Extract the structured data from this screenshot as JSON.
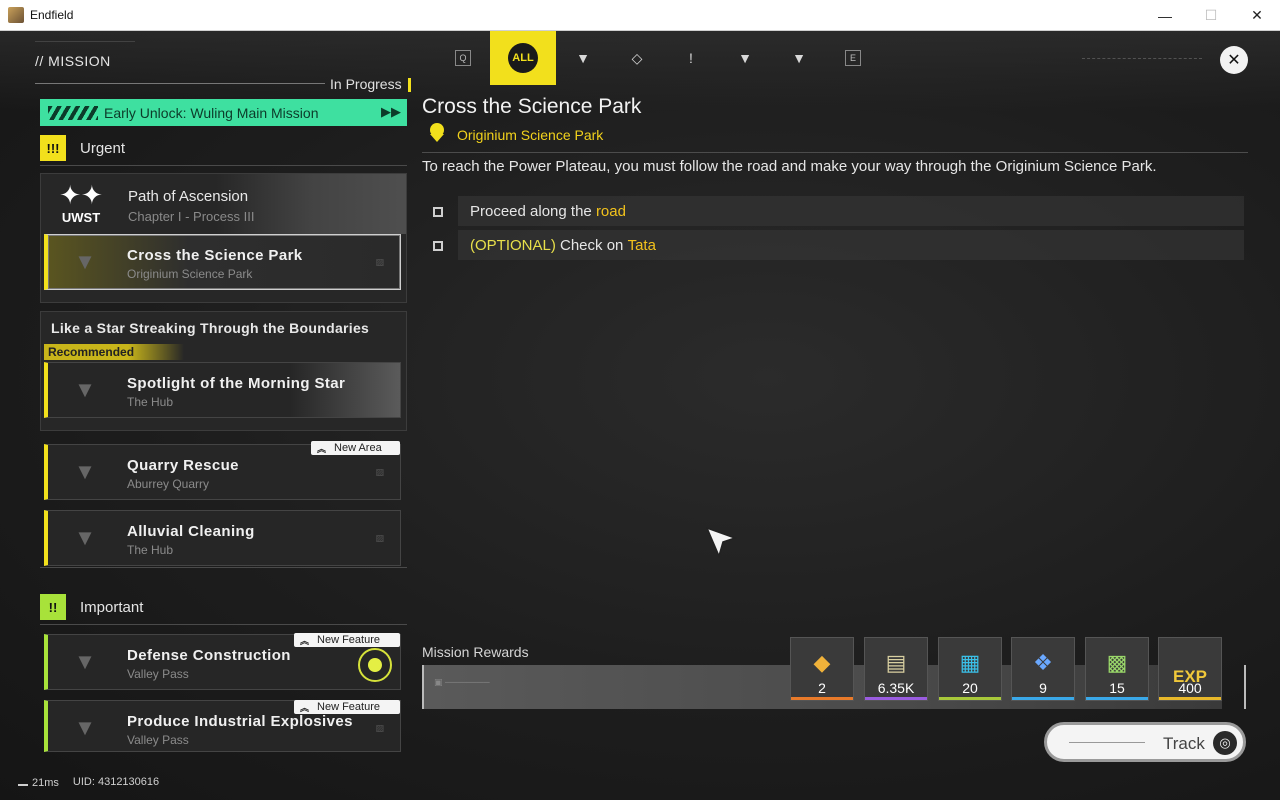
{
  "window": {
    "title": "Endfield",
    "minimize": "—",
    "maximize": "☐",
    "close": "✕"
  },
  "header": {
    "section_title": "// MISSION"
  },
  "tabs": [
    {
      "label": "Q"
    },
    {
      "label": "ALL"
    },
    {
      "label": "▼"
    },
    {
      "label": "◇"
    },
    {
      "label": "!"
    },
    {
      "label": "▼"
    },
    {
      "label": "▼"
    },
    {
      "label": "E"
    }
  ],
  "list": {
    "in_progress_label": "In Progress",
    "early_unlock": "Early Unlock: Wuling Main Mission",
    "urgent": {
      "badge": "!!!",
      "label": "Urgent"
    },
    "important": {
      "badge": "!!",
      "label": "Important"
    },
    "group1": {
      "logo_text": "UWST",
      "title": "Path of Ascension",
      "subtitle": "Chapter I - Process III"
    },
    "group2": {
      "title": "Like a Star Streaking Through the Boundaries",
      "recommended": "Recommended"
    },
    "missions": [
      {
        "title": "Cross the Science Park",
        "location": "Originium Science Park"
      },
      {
        "title": "Spotlight of the Morning Star",
        "location": "The Hub"
      },
      {
        "title": "Quarry Rescue",
        "location": "Aburrey Quarry",
        "badge": "New Area"
      },
      {
        "title": "Alluvial Cleaning",
        "location": "The Hub"
      },
      {
        "title": "Defense Construction",
        "location": "Valley Pass",
        "badge": "New Feature"
      },
      {
        "title": "Produce Industrial Explosives",
        "location": "Valley Pass",
        "badge": "New Feature"
      }
    ]
  },
  "detail": {
    "title": "Cross the Science Park",
    "location": "Originium Science Park",
    "description": "To reach the Power Plateau, you must follow the road and make your way through the Originium Science Park.",
    "objectives": [
      {
        "prefix": "",
        "text": "Proceed along the ",
        "highlight": "road"
      },
      {
        "prefix": "(OPTIONAL)",
        "text": " Check on ",
        "highlight": "Tata"
      }
    ]
  },
  "rewards": {
    "label": "Mission Rewards",
    "items": [
      {
        "icon": "gold-crystal-icon",
        "qty": "2",
        "rarity": "#e87a2a"
      },
      {
        "icon": "ticket-bundle-icon",
        "qty": "6.35K",
        "rarity": "#9a5ce0"
      },
      {
        "icon": "exp-card-icon",
        "qty": "20",
        "rarity": "#a8c83a"
      },
      {
        "icon": "blue-crystal-icon",
        "qty": "9",
        "rarity": "#3aa8e8"
      },
      {
        "icon": "machine-part-icon",
        "qty": "15",
        "rarity": "#3aa8e8"
      },
      {
        "icon": "exp-icon",
        "qty": "400",
        "rarity": "#e8b82a",
        "text": "EXP"
      }
    ]
  },
  "track_button": {
    "label": "Track"
  },
  "status": {
    "ping": "21ms",
    "uid": "UID: 4312130616"
  }
}
